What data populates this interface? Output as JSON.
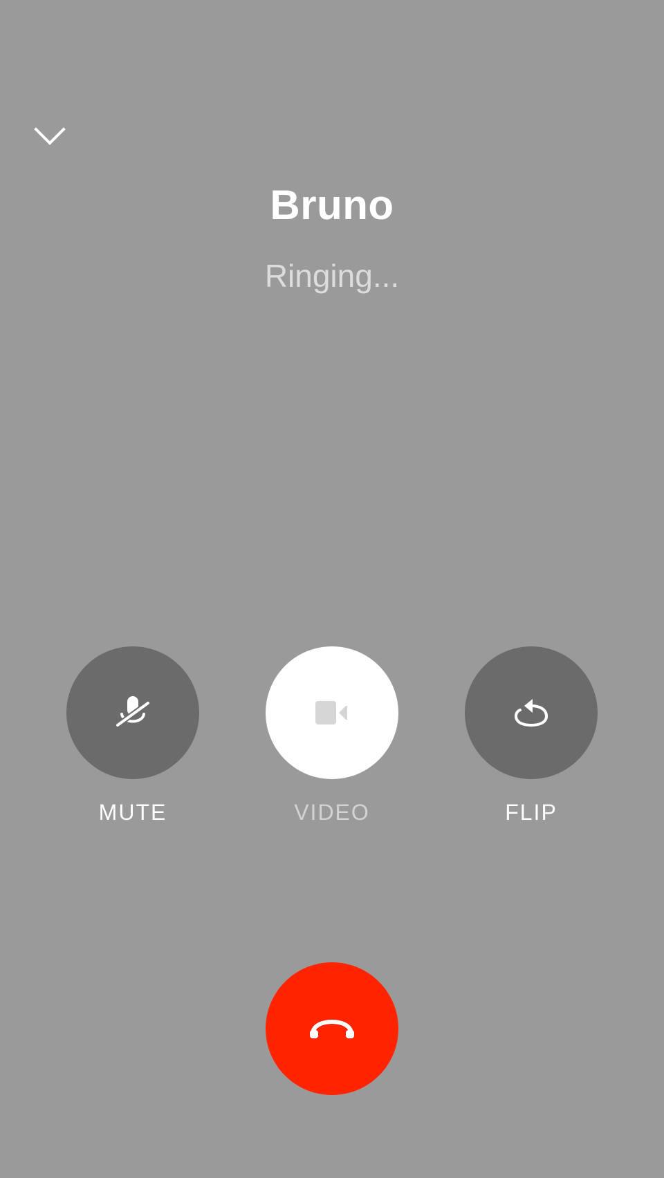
{
  "call": {
    "name": "Bruno",
    "status": "Ringing..."
  },
  "controls": {
    "mute_label": "MUTE",
    "video_label": "VIDEO",
    "flip_label": "FLIP"
  },
  "icons": {
    "collapse": "chevron-down-icon",
    "mute": "microphone-muted-icon",
    "video": "video-camera-icon",
    "flip": "camera-flip-icon",
    "end_call": "phone-hangup-icon"
  },
  "colors": {
    "background": "#9a9a9a",
    "button_dark": "#6b6b6b",
    "button_light": "#ffffff",
    "end_call": "#ff2400"
  }
}
